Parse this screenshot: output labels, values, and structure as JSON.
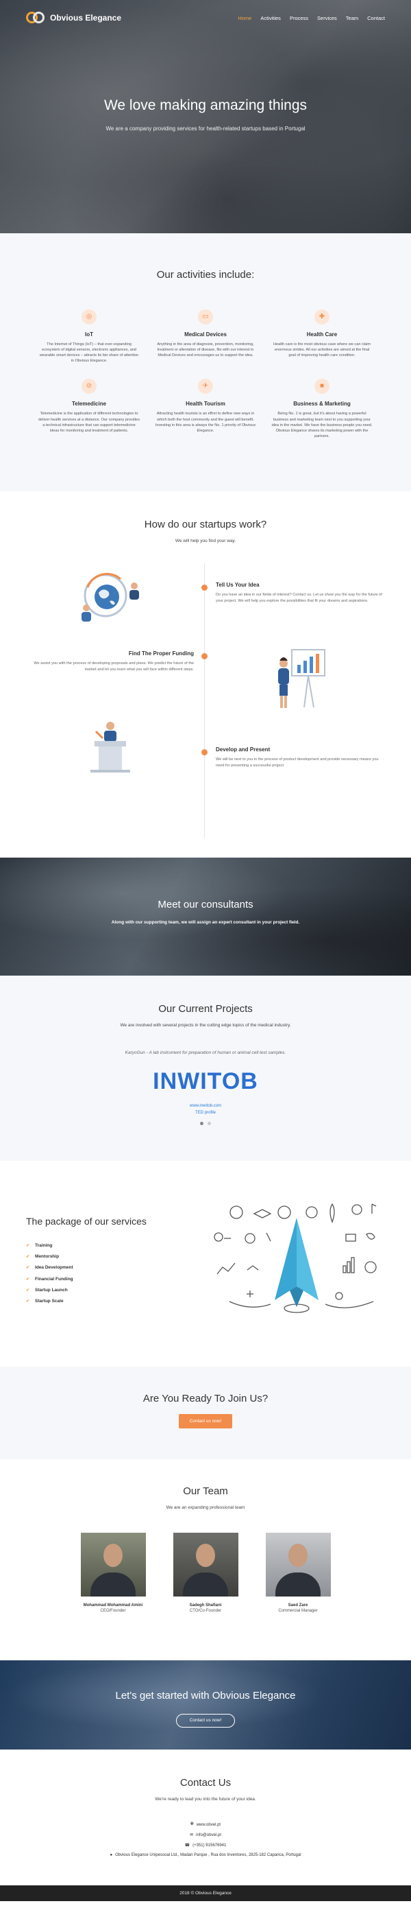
{
  "brand": {
    "name": "Obvious Elegance",
    "accent": "#f0a23b",
    "orange": "#f28c4a"
  },
  "nav": {
    "items": [
      "Home",
      "Activities",
      "Process",
      "Services",
      "Team",
      "Contact"
    ],
    "active": "Home"
  },
  "hero": {
    "title": "We love making amazing things",
    "subtitle": "We are a company providing services for health-related startups based in Portugal"
  },
  "activities": {
    "title": "Our activities include:",
    "items": [
      {
        "icon": "microchip-icon",
        "title": "IoT",
        "text": "The Internet of Things (IoT) – that ever-expanding ecosystem of digital sensors, electronic appliances, and wearable smart devices – attracts its fair share of attention in Obvious Elegance."
      },
      {
        "icon": "ambulance-icon",
        "title": "Medical Devices",
        "text": "Anything in the area of diagnosis, prevention, monitoring, treatment or alleviation of disease, fits with our interest in Medical Devices and encourages us to support the idea."
      },
      {
        "icon": "first-aid-kit-icon",
        "title": "Health Care",
        "text": "Health care is the most obvious case where we can claim enormous strides. All our activities are aimed at the final goal of improving health care condition."
      },
      {
        "icon": "stethoscope-icon",
        "title": "Telemedicine",
        "text": "Telemedicine is the application of different technologies to deliver health services at a distance. Our company provides a technical infrastructure that can support telemedicine ideas for monitoring and treatment of patients."
      },
      {
        "icon": "plane-icon",
        "title": "Health Tourism",
        "text": "Attracting health tourists is an effort to define new ways in which both the host community and the guest will benefit. Investing in this area is always the No. 1 priority of Obvious Elegance."
      },
      {
        "icon": "briefcase-icon",
        "title": "Business & Marketing",
        "text": "Being No. 1 is great, but it's about having a powerful business and marketing team next to you supporting your idea in the market. We have the business people you need. Obvious Elegance shares its marketing power with the partners."
      }
    ]
  },
  "how": {
    "title": "How do our startups work?",
    "subtitle": "We will help you find your way.",
    "steps": [
      {
        "title": "Tell Us Your Idea",
        "text": "Do you have an idea in our fields of interest? Contact us. Let us show you the way for the future of your project. We will help you explore the possibilities that fit your dreams and aspirations."
      },
      {
        "title": "Find The Proper Funding",
        "text": "We assist you with the process of developing proposals and plans. We predict the future of the market and let you learn what you will face within different steps."
      },
      {
        "title": "Develop and Present",
        "text": "We will be next to you in the process of product development and provide necessary means you need for presenting a successful project."
      }
    ]
  },
  "consultants": {
    "title": "Meet our consultants",
    "subtitle": "Along with our supporting team, we will assign an expert consultant in your project field."
  },
  "projects": {
    "title": "Our Current Projects",
    "subtitle": "We are involved with several projects in the cutting edge topics of the medical industry.",
    "quote": "KaryoGun - A lab instrument for preparation of human or animal cell test samples.",
    "logo_text": "INWITOB",
    "link": "www.inwitob.com",
    "link2": "TED profile"
  },
  "package": {
    "title": "The package of our services",
    "items": [
      "Training",
      "Mentorship",
      "Idea Development",
      "Financial Funding",
      "Startup Launch",
      "Startup Scale"
    ]
  },
  "join": {
    "title": "Are You Ready To Join Us?",
    "button": "Contact us now!"
  },
  "team": {
    "title": "Our Team",
    "subtitle": "We are an expanding professional team",
    "members": [
      {
        "name": "Mohammad Mohammad Amini",
        "role": "CEO/Founder"
      },
      {
        "name": "Sadegh Shafiani",
        "role": "CTO/Co-Founder"
      },
      {
        "name": "Saed Zare",
        "role": "Commercial Manager"
      }
    ]
  },
  "cta": {
    "title": "Let's get started with Obvious Elegance",
    "button": "Contact us now!"
  },
  "contact": {
    "title": "Contact Us",
    "subtitle": "We're ready to lead you into the future of your idea.",
    "web": "www.obvel.pt",
    "email": "info@obvel.pt",
    "phone": "(+351) 915676941",
    "address": "Obvious Elegance Unipessoal Ltd., Madan Parque , Rua dos Inventores, 2825-182 Caparica, Portugal"
  },
  "footer": "2018 © Obvious Elegance"
}
